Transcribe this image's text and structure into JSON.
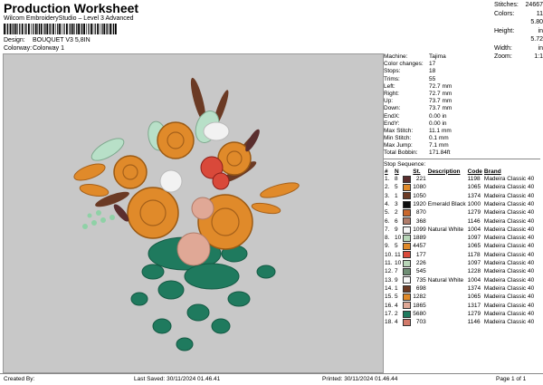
{
  "header": {
    "title": "Production Worksheet",
    "subtitle": "Wilcom EmbroideryStudio – Level 3 Advanced",
    "design_label": "Design:",
    "design_value": "BOUQUET V3 5,8IN",
    "colorway_label": "Colorway:",
    "colorway_value": "Colorway 1"
  },
  "stats": [
    {
      "label": "Stitches:",
      "value": "24667"
    },
    {
      "label": "Colors:",
      "value": "11"
    },
    {
      "label": "Height:",
      "value": "5.80 in"
    },
    {
      "label": "Width:",
      "value": "5.72 in"
    },
    {
      "label": "Zoom:",
      "value": "1:1"
    }
  ],
  "machine": [
    {
      "label": "Machine:",
      "value": "Tajima"
    },
    {
      "label": "Color changes:",
      "value": "17"
    },
    {
      "label": "Stops:",
      "value": "18"
    },
    {
      "label": "Trims:",
      "value": "55"
    },
    {
      "label": "Left:",
      "value": "72.7 mm"
    },
    {
      "label": "Right:",
      "value": "72.7 mm"
    },
    {
      "label": "Up:",
      "value": "73.7 mm"
    },
    {
      "label": "Down:",
      "value": "73.7 mm"
    },
    {
      "label": "EndX:",
      "value": "0.00 in"
    },
    {
      "label": "EndY:",
      "value": "0.00 in"
    },
    {
      "label": "Max Stitch:",
      "value": "11.1 mm"
    },
    {
      "label": "Min Stitch:",
      "value": "0.1 mm"
    },
    {
      "label": "Max Jump:",
      "value": "7.1 mm"
    },
    {
      "label": "Total Bobbin:",
      "value": "171.84ft"
    }
  ],
  "stop_sequence": {
    "title": "Stop Sequence:",
    "headers": [
      "#",
      "N",
      "St.",
      "Description",
      "Code",
      "Brand"
    ],
    "rows": [
      {
        "n": "1.",
        "needle": "8",
        "color": "#5a2e2e",
        "st": "221",
        "desc": "",
        "code": "1198",
        "brand": "Madeira Classic 40"
      },
      {
        "n": "2.",
        "needle": "5",
        "color": "#e08a2a",
        "st": "1080",
        "desc": "",
        "code": "1065",
        "brand": "Madeira Classic 40"
      },
      {
        "n": "3.",
        "needle": "1",
        "color": "#6b3a24",
        "st": "1050",
        "desc": "",
        "code": "1374",
        "brand": "Madeira Classic 40"
      },
      {
        "n": "4.",
        "needle": "3",
        "color": "#0e0e0e",
        "st": "1920",
        "desc": "Emerald Black",
        "code": "1000",
        "brand": "Madeira Classic 40"
      },
      {
        "n": "5.",
        "needle": "2",
        "color": "#c9682e",
        "st": "870",
        "desc": "",
        "code": "1279",
        "brand": "Madeira Classic 40"
      },
      {
        "n": "6.",
        "needle": "6",
        "color": "#b07c6a",
        "st": "368",
        "desc": "",
        "code": "1146",
        "brand": "Madeira Classic 40"
      },
      {
        "n": "7.",
        "needle": "9",
        "color": "#f6f6f6",
        "st": "1099",
        "desc": "Natural White",
        "code": "1004",
        "brand": "Madeira Classic 40"
      },
      {
        "n": "8.",
        "needle": "10",
        "color": "#b8d6b8",
        "st": "1889",
        "desc": "",
        "code": "1097",
        "brand": "Madeira Classic 40"
      },
      {
        "n": "9.",
        "needle": "5",
        "color": "#e08a2a",
        "st": "4457",
        "desc": "",
        "code": "1065",
        "brand": "Madeira Classic 40"
      },
      {
        "n": "10.",
        "needle": "11",
        "color": "#d9493a",
        "st": "177",
        "desc": "",
        "code": "1178",
        "brand": "Madeira Classic 40"
      },
      {
        "n": "11.",
        "needle": "10",
        "color": "#b8d6b8",
        "st": "226",
        "desc": "",
        "code": "1097",
        "brand": "Madeira Classic 40"
      },
      {
        "n": "12.",
        "needle": "7",
        "color": "#6f8e74",
        "st": "545",
        "desc": "",
        "code": "1228",
        "brand": "Madeira Classic 40"
      },
      {
        "n": "13.",
        "needle": "9",
        "color": "#f6f6f6",
        "st": "735",
        "desc": "Natural White",
        "code": "1004",
        "brand": "Madeira Classic 40"
      },
      {
        "n": "14.",
        "needle": "1",
        "color": "#6b3a24",
        "st": "698",
        "desc": "",
        "code": "1374",
        "brand": "Madeira Classic 40"
      },
      {
        "n": "15.",
        "needle": "5",
        "color": "#e08a2a",
        "st": "1282",
        "desc": "",
        "code": "1065",
        "brand": "Madeira Classic 40"
      },
      {
        "n": "16.",
        "needle": "4",
        "color": "#e0a896",
        "st": "1865",
        "desc": "",
        "code": "1317",
        "brand": "Madeira Classic 40"
      },
      {
        "n": "17.",
        "needle": "2",
        "color": "#1f7a5e",
        "st": "5680",
        "desc": "",
        "code": "1279",
        "brand": "Madeira Classic 40"
      },
      {
        "n": "18.",
        "needle": "4",
        "color": "#d27a6a",
        "st": "703",
        "desc": "",
        "code": "1146",
        "brand": "Madeira Classic 40"
      }
    ]
  },
  "footer": {
    "created": "Created By:",
    "saved": "Last Saved: 30/11/2024 01.46.41",
    "printed": "Printed: 30/11/2024 01.46.44",
    "page": "Page 1 of 1"
  }
}
